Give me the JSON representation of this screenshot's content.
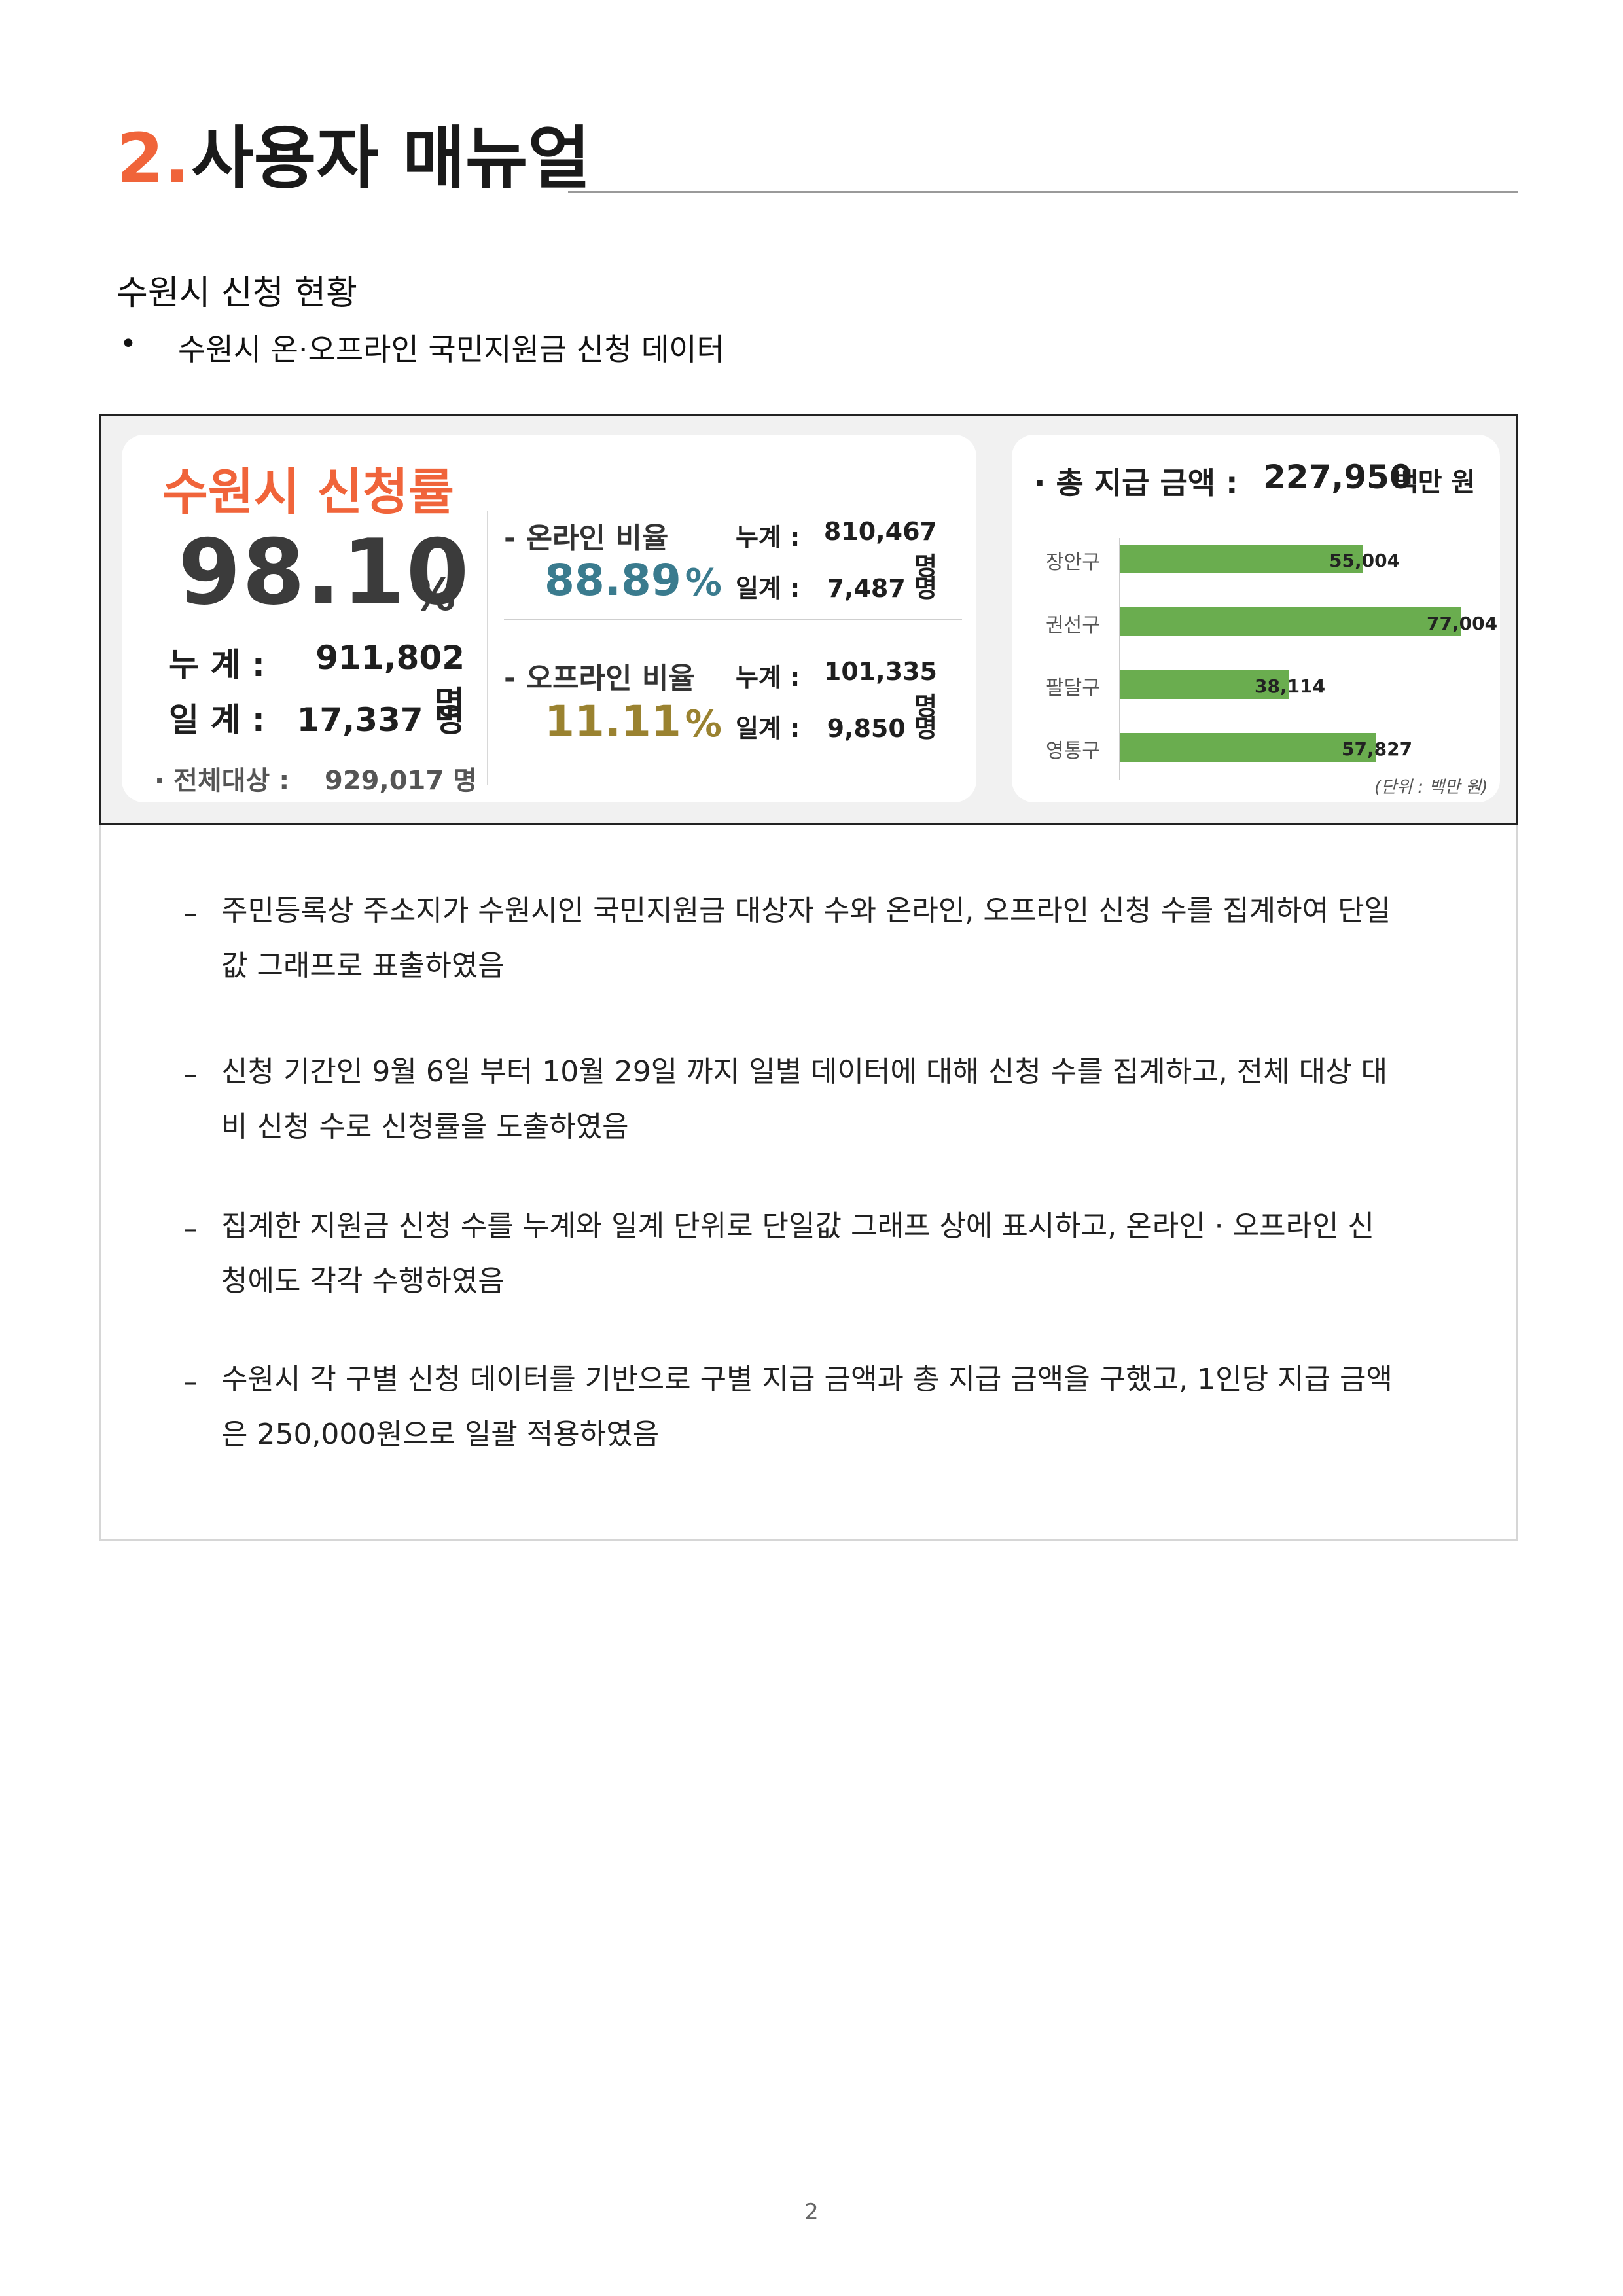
{
  "heading": {
    "number": "2.",
    "title": "사용자 매뉴얼"
  },
  "subtitle": "수원시 신청 현황",
  "bullet": {
    "mark": "•",
    "text": "수원시 온·오프라인 국민지원금 신청 데이터"
  },
  "dashboard": {
    "rate_title": "수원시 신청률",
    "rate_value": "98.10",
    "rate_unit": "%",
    "cumulative_label": "누  계 :",
    "cumulative_value": "911,802 명",
    "daily_label": "일  계 :",
    "daily_value": "17,337 명",
    "total_label": "· 전체대상 :",
    "total_value": "929,017 명",
    "online": {
      "label": "- 온라인 비율",
      "pct": "88.89",
      "pct_unit": "%",
      "cum_label": "누계 :",
      "cum_value": "810,467 명",
      "day_label": "일계 :",
      "day_value": "7,487 명"
    },
    "offline": {
      "label": "- 오프라인 비율",
      "pct": "11.11",
      "pct_unit": "%",
      "cum_label": "누계 :",
      "cum_value": "101,335 명",
      "day_label": "일계 :",
      "day_value": "9,850 명"
    },
    "payment": {
      "title": "· 총 지급 금액 :",
      "value": "227,950",
      "unit": "백만 원",
      "unit_note": "(단위 : 백만 원)",
      "bar_color": "#6aad4f"
    }
  },
  "chart_data": {
    "type": "bar",
    "orientation": "horizontal",
    "categories": [
      "장안구",
      "권선구",
      "팔달구",
      "영통구"
    ],
    "values": [
      55004,
      77004,
      38114,
      57827
    ],
    "value_labels": [
      "55,004",
      "77,004",
      "38,114",
      "57,827"
    ],
    "unit": "(단위 : 백만 원)"
  },
  "description": [
    "주민등록상 주소지가 수원시인 국민지원금 대상자 수와 온라인, 오프라인 신청 수를 집계하여 단일값 그래프로 표출하였음",
    "신청 기간인 9월 6일 부터 10월 29일 까지 일별 데이터에 대해 신청 수를 집계하고, 전체 대상 대비 신청 수로 신청률을 도출하였음",
    "집계한 지원금 신청 수를 누계와 일계 단위로 단일값 그래프 상에 표시하고, 온라인 · 오프라인 신청에도 각각 수행하였음",
    "수원시 각 구별 신청 데이터를 기반으로 구별 지급 금액과 총 지급 금액을 구했고, 1인당 지급 금액은 250,000원으로 일괄 적용하였음"
  ],
  "dash_mark": "–",
  "page_number": "2"
}
